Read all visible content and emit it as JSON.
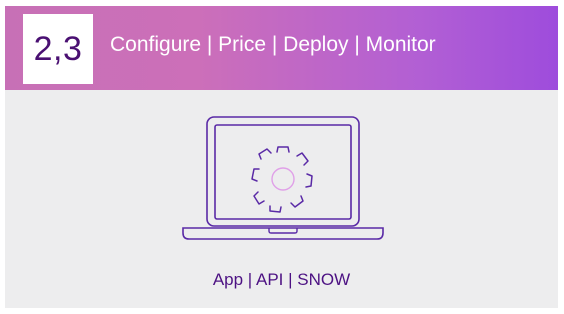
{
  "banner": {
    "step_number": "2,3",
    "title": "Configure | Price | Deploy | Monitor"
  },
  "illustration": {
    "icon": "laptop-gear-icon",
    "stroke_color": "#5a2aa6",
    "accent_color": "#e0a0e8"
  },
  "footer": {
    "label": "App | API | SNOW"
  },
  "colors": {
    "background": "#ededee",
    "banner_start": "#c770b6",
    "banner_end": "#9e4cdc",
    "number_text": "#4a1072",
    "footer_text": "#4d1283"
  }
}
